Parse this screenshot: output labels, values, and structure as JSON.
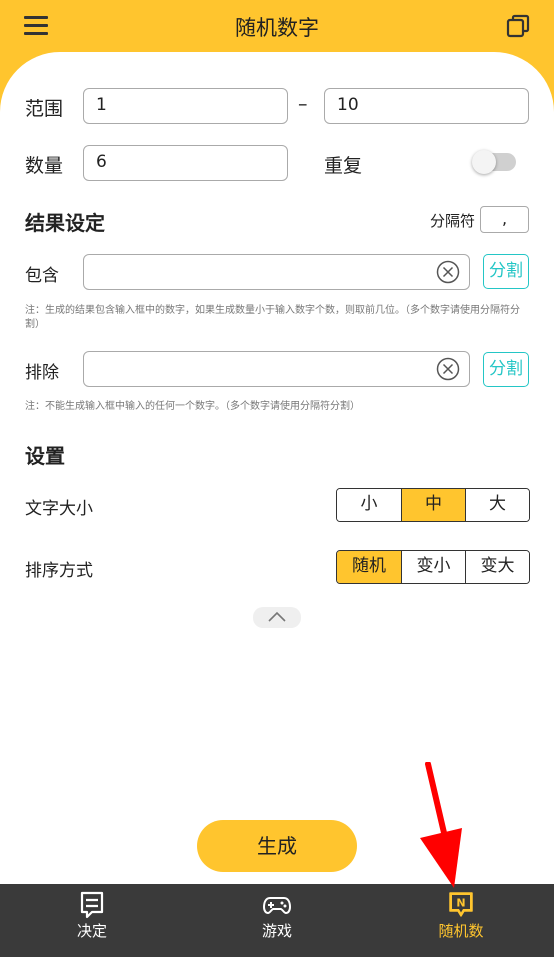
{
  "header": {
    "title": "随机数字",
    "menu_icon": "hamburger-menu-icon",
    "copy_icon": "copy-icon"
  },
  "range": {
    "label": "范围",
    "min": "1",
    "dash": "–",
    "max": "10"
  },
  "quantity": {
    "label": "数量",
    "value": "6"
  },
  "repeat": {
    "label": "重复",
    "enabled": false
  },
  "result_settings": {
    "heading": "结果设定",
    "separator_label": "分隔符",
    "separator_value": ","
  },
  "include": {
    "label": "包含",
    "value": "",
    "split_label": "分割",
    "note": "注：生成的结果包含输入框中的数字，如果生成数量小于输入数字个数，则取前几位。（多个数字请使用分隔符分割）"
  },
  "exclude": {
    "label": "排除",
    "value": "",
    "split_label": "分割",
    "note": "注：不能生成输入框中输入的任何一个数字。（多个数字请使用分隔符分割）"
  },
  "settings": {
    "heading": "设置",
    "font_size": {
      "label": "文字大小",
      "options": [
        "小",
        "中",
        "大"
      ],
      "selected": "中"
    },
    "sort": {
      "label": "排序方式",
      "options": [
        "随机",
        "变小",
        "变大"
      ],
      "selected": "随机"
    }
  },
  "generate_button": "生成",
  "bottom_nav": {
    "items": [
      {
        "label": "决定",
        "icon": "decide-icon",
        "active": false
      },
      {
        "label": "游戏",
        "icon": "gamepad-icon",
        "active": false
      },
      {
        "label": "随机数",
        "icon": "random-number-icon",
        "active": true
      }
    ]
  },
  "colors": {
    "accent": "#FFC52E",
    "split_button": "#24C6C6",
    "nav_background": "#3a3a3a",
    "annotation_arrow": "#FF0000"
  }
}
